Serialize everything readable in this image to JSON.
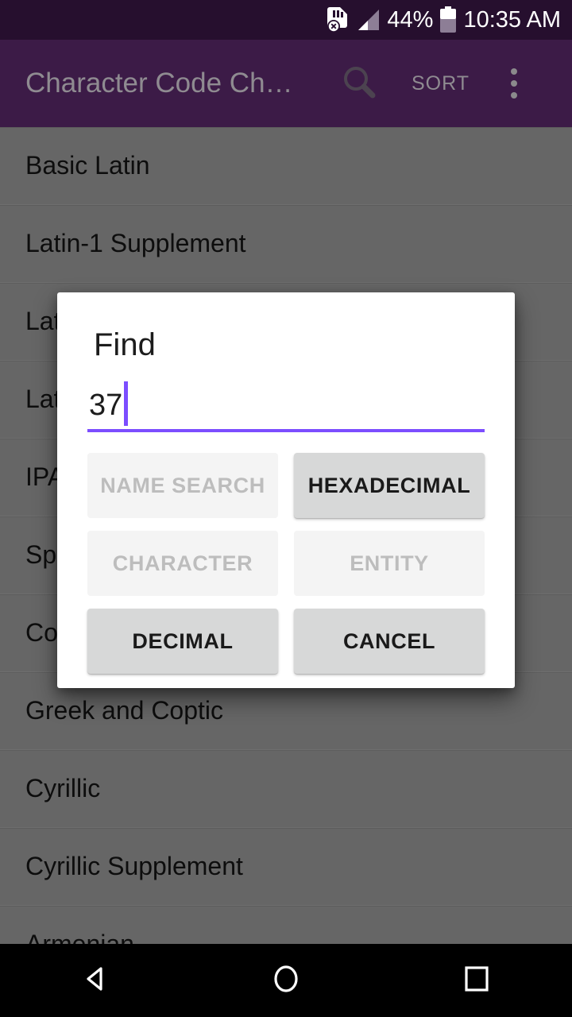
{
  "status_bar": {
    "battery_percent": "44%",
    "time": "10:35 AM",
    "icons": [
      "sim-card-error-icon",
      "signal-icon",
      "battery-icon"
    ]
  },
  "app_bar": {
    "title": "Character Code Ch…",
    "search_label": "search-icon",
    "sort_label": "SORT",
    "overflow_label": "more-options-icon",
    "background_color": "#3c1b47"
  },
  "list": {
    "rows": [
      {
        "label": "Basic Latin"
      },
      {
        "label": "Latin-1 Supplement"
      },
      {
        "label": "Latin Extended-A"
      },
      {
        "label": "Latin Extended-B"
      },
      {
        "label": "IPA Extensions"
      },
      {
        "label": "Spacing Modifier Letters"
      },
      {
        "label": "Combining Diacritical Marks"
      },
      {
        "label": "Greek and Coptic"
      },
      {
        "label": "Cyrillic"
      },
      {
        "label": "Cyrillic Supplement"
      },
      {
        "label": "Armenian"
      }
    ]
  },
  "dialog": {
    "title": "Find",
    "input_value": "37",
    "input_placeholder": "",
    "accent_color": "#7c4dff",
    "buttons": [
      {
        "label": "NAME SEARCH",
        "state": "disabled"
      },
      {
        "label": "HEXADECIMAL",
        "state": "enabled"
      },
      {
        "label": "CHARACTER",
        "state": "disabled"
      },
      {
        "label": "ENTITY",
        "state": "disabled"
      },
      {
        "label": "DECIMAL",
        "state": "enabled"
      },
      {
        "label": "CANCEL",
        "state": "enabled"
      }
    ]
  },
  "nav_bar": {
    "back": "back-icon",
    "home": "home-icon",
    "recents": "recents-icon"
  }
}
